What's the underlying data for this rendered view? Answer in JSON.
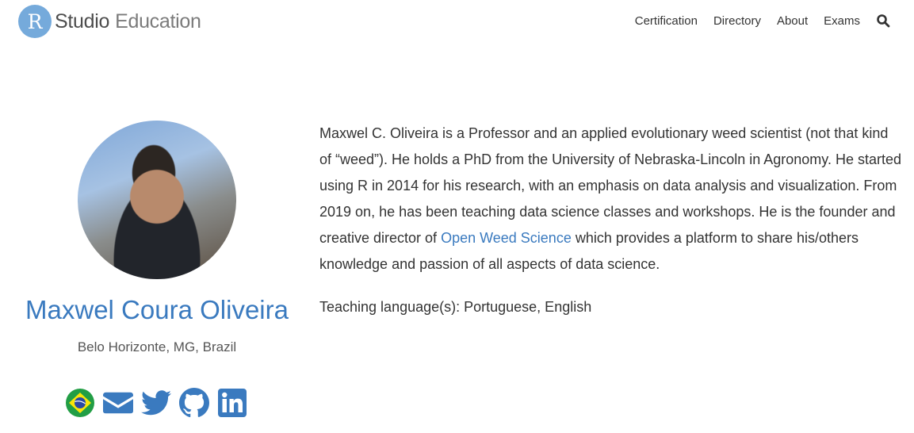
{
  "logo": {
    "letter": "R",
    "studio": "Studio",
    "education": "Education"
  },
  "nav": {
    "items": [
      {
        "label": "Certification"
      },
      {
        "label": "Directory"
      },
      {
        "label": "About"
      },
      {
        "label": "Exams"
      }
    ],
    "search_icon": "search-icon"
  },
  "profile": {
    "name": "Maxwel Coura Oliveira",
    "location": "Belo Horizonte, MG, Brazil",
    "social": [
      "brazil-flag-icon",
      "email-icon",
      "twitter-icon",
      "github-icon",
      "linkedin-icon"
    ]
  },
  "bio": {
    "before_link": "Maxwel C. Oliveira is a Professor and an applied evolutionary weed scientist (not that kind of “weed”). He holds a PhD from the University of Nebraska-Lincoln in Agronomy. He started using R in 2014 for his research, with an emphasis on data analysis and visualization. From 2019 on, he has been teaching data science classes and workshops. He is the founder and creative director of ",
    "link_text": "Open Weed Science",
    "after_link": " which provides a platform to share his/others knowledge and passion of all aspects of data science.",
    "languages": "Teaching language(s): Portuguese, English"
  },
  "colors": {
    "accent": "#3a7abf",
    "logo_blue": "#75AADB",
    "flag_green": "#229e45",
    "flag_yellow": "#f8e509",
    "flag_blue": "#2b49a3"
  }
}
